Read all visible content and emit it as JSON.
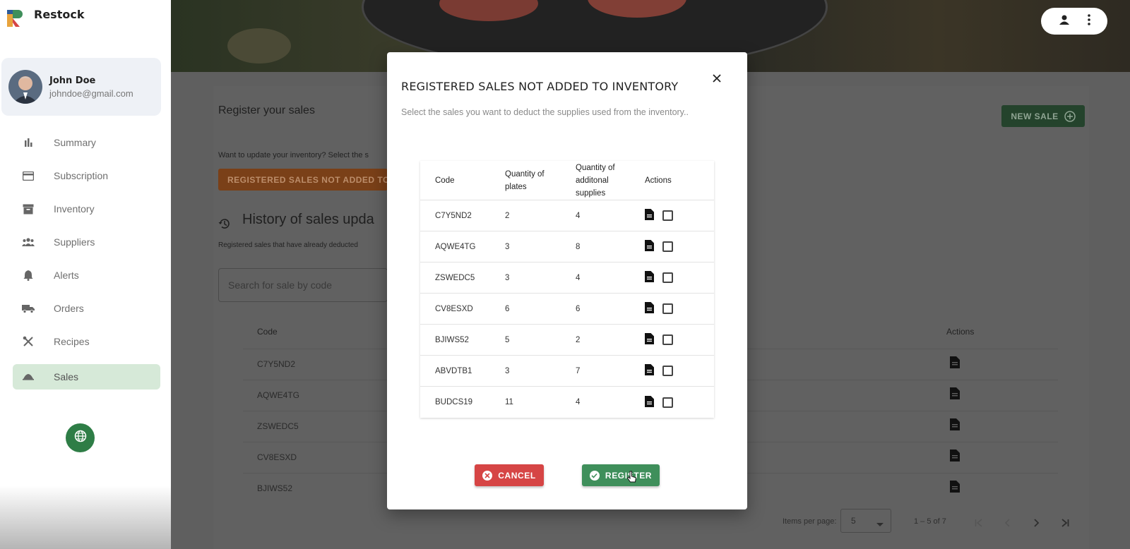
{
  "app": {
    "name": "Restock"
  },
  "profile": {
    "name": "John Doe",
    "email": "johndoe@gmail.com"
  },
  "sidebar": {
    "items": [
      {
        "label": "Summary",
        "icon": "bar-chart-icon"
      },
      {
        "label": "Subscription",
        "icon": "credit-card-icon"
      },
      {
        "label": "Inventory",
        "icon": "archive-icon"
      },
      {
        "label": "Suppliers",
        "icon": "groups-icon"
      },
      {
        "label": "Alerts",
        "icon": "bell-icon"
      },
      {
        "label": "Orders",
        "icon": "truck-icon"
      },
      {
        "label": "Recipes",
        "icon": "utensils-icon"
      },
      {
        "label": "Sales",
        "icon": "cloche-icon",
        "active": true
      }
    ]
  },
  "page": {
    "title": "Register your sales",
    "update_text": "Want to update your inventory? Select the s",
    "pending_button": "REGISTERED SALES NOT ADDED TO",
    "new_sale_button": "NEW SALE",
    "history_title": "History of sales upda",
    "history_subtitle": "Registered sales that have already deducted",
    "search_placeholder": "Search for sale by code",
    "table": {
      "code_header": "Code",
      "actions_header": "Actions",
      "rows": [
        "C7Y5ND2",
        "AQWE4TG",
        "ZSWEDC5",
        "CV8ESXD",
        "BJIWS52"
      ]
    },
    "pagination": {
      "items_per_page_label": "Items per page:",
      "items_per_page_value": "5",
      "range": "1 – 5 of 7"
    }
  },
  "modal": {
    "title": "REGISTERED SALES NOT ADDED TO INVENTORY",
    "subtitle": "Select the sales you want to deduct the supplies used from the inventory..",
    "headers": {
      "code": "Code",
      "plates_line1": "Quantity of",
      "plates_line2": "plates",
      "supplies_line1": "Quantity of",
      "supplies_line2": "additonal",
      "supplies_line3": "supplies",
      "actions": "Actions"
    },
    "rows": [
      {
        "code": "C7Y5ND2",
        "plates": "2",
        "supplies": "4"
      },
      {
        "code": "AQWE4TG",
        "plates": "3",
        "supplies": "8"
      },
      {
        "code": "ZSWEDC5",
        "plates": "3",
        "supplies": "4"
      },
      {
        "code": "CV8ESXD",
        "plates": "6",
        "supplies": "6"
      },
      {
        "code": "BJIWS52",
        "plates": "5",
        "supplies": "2"
      },
      {
        "code": "ABVDTB1",
        "plates": "3",
        "supplies": "7"
      },
      {
        "code": "BUDCS19",
        "plates": "11",
        "supplies": "4"
      }
    ],
    "cancel_label": "CANCEL",
    "register_label": "REGISTER"
  },
  "colors": {
    "accent_green": "#3f8f5b",
    "active_nav": "#d6e9d8",
    "cancel_red": "#d64545",
    "pending_orange": "#e07b2e"
  }
}
